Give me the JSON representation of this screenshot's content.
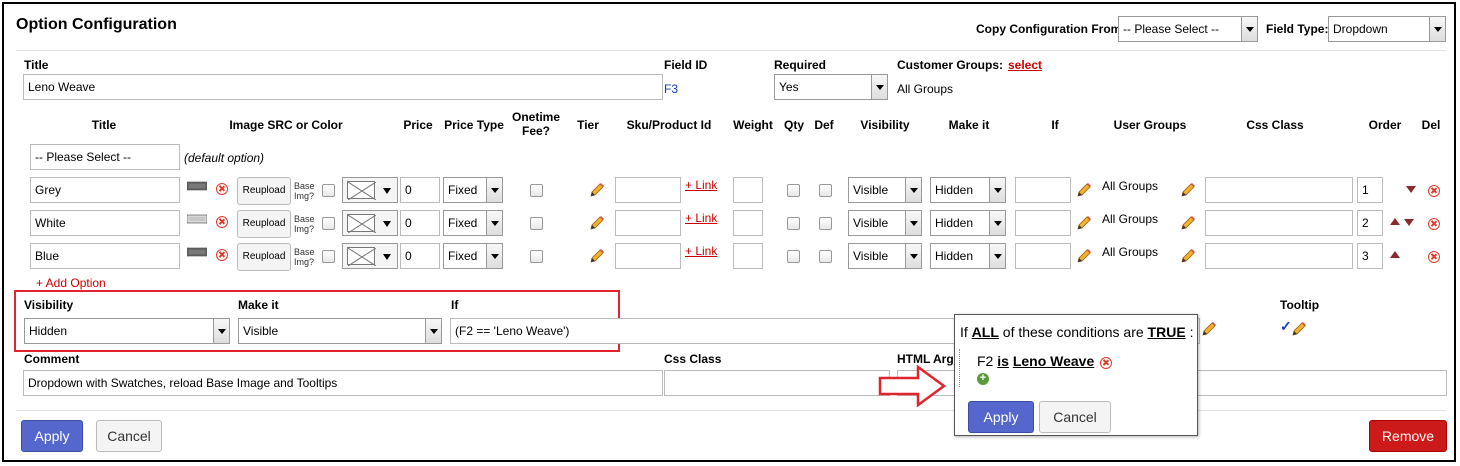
{
  "header": {
    "title": "Option Configuration",
    "copy_label": "Copy Configuration From:",
    "copy_value": "-- Please Select --",
    "field_type_label": "Field Type:",
    "field_type_value": "Dropdown"
  },
  "top": {
    "title_label": "Title",
    "title_value": "Leno Weave",
    "field_id_label": "Field ID",
    "field_id_value": "F3",
    "required_label": "Required",
    "required_value": "Yes",
    "customer_groups_label": "Customer Groups:",
    "customer_groups_link": "select",
    "customer_groups_value": "All Groups"
  },
  "columns": [
    "Title",
    "Image SRC or Color",
    "Price",
    "Price Type",
    "Onetime Fee?",
    "Tier",
    "Sku/Product Id",
    "Weight",
    "Qty",
    "Def",
    "Visibility",
    "Make it",
    "If",
    "User Groups",
    "Css Class",
    "Order",
    "Del"
  ],
  "default_row": {
    "select": "-- Please Select --",
    "note": "(default option)"
  },
  "rows": [
    {
      "title": "Grey",
      "reupload": "Reupload",
      "base_img": "Base Img?",
      "price": "0",
      "price_type": "Fixed",
      "link": "+ Link",
      "visibility": "Visible",
      "make_it": "Hidden",
      "user_groups": "All Groups",
      "order": "1"
    },
    {
      "title": "White",
      "reupload": "Reupload",
      "base_img": "Base Img?",
      "price": "0",
      "price_type": "Fixed",
      "link": "+ Link",
      "visibility": "Visible",
      "make_it": "Hidden",
      "user_groups": "All Groups",
      "order": "2"
    },
    {
      "title": "Blue",
      "reupload": "Reupload",
      "base_img": "Base Img?",
      "price": "0",
      "price_type": "Fixed",
      "link": "+ Link",
      "visibility": "Visible",
      "make_it": "Hidden",
      "user_groups": "All Groups",
      "order": "3"
    }
  ],
  "add_option": "+ Add Option",
  "condition": {
    "visibility_label": "Visibility",
    "visibility_value": "Hidden",
    "make_it_label": "Make it",
    "make_it_value": "Visible",
    "if_label": "If",
    "if_value": "(F2 == 'Leno Weave')",
    "tooltip_label": "Tooltip"
  },
  "bottom": {
    "comment_label": "Comment",
    "comment_value": "Dropdown with Swatches, reload Base Image and Tooltips",
    "css_class_label": "Css Class",
    "html_arg_label": "HTML Arg"
  },
  "popup": {
    "if_text": "If",
    "all_text": "ALL",
    "middle_text": "of these conditions are",
    "true_text": "TRUE",
    "colon": ":",
    "cond_field": "F2",
    "cond_op": "is",
    "cond_value": "Leno Weave",
    "apply": "Apply",
    "cancel": "Cancel"
  },
  "footer": {
    "apply": "Apply",
    "cancel": "Cancel",
    "remove": "Remove"
  },
  "colors": {
    "accent_blue": "#5566cc",
    "remove_red": "#cc1a1a",
    "highlight_red": "#e0262c",
    "link_red": "#cc0000"
  }
}
